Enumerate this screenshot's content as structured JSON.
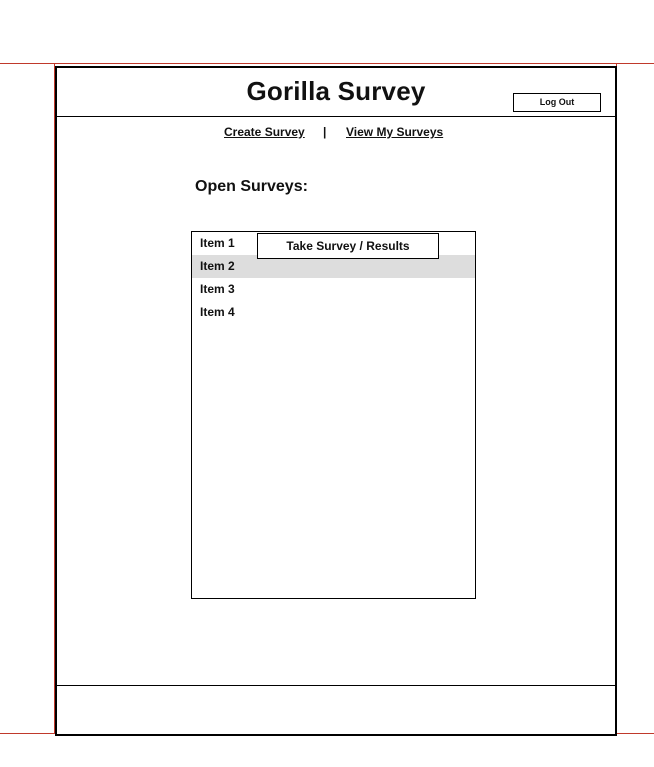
{
  "header": {
    "title": "Gorilla Survey",
    "logout_label": "Log Out"
  },
  "nav": {
    "create_label": "Create Survey",
    "separator": "|",
    "view_label": "View My Surveys"
  },
  "main": {
    "heading": "Open Surveys:",
    "take_button_label": "Take Survey / Results",
    "items": [
      {
        "label": "Item 1"
      },
      {
        "label": "Item 2",
        "selected": true
      },
      {
        "label": "Item 3"
      },
      {
        "label": "Item 4"
      }
    ]
  },
  "colors": {
    "guide": "#c0392b",
    "selected_row": "#dddddd",
    "border": "#000000"
  }
}
